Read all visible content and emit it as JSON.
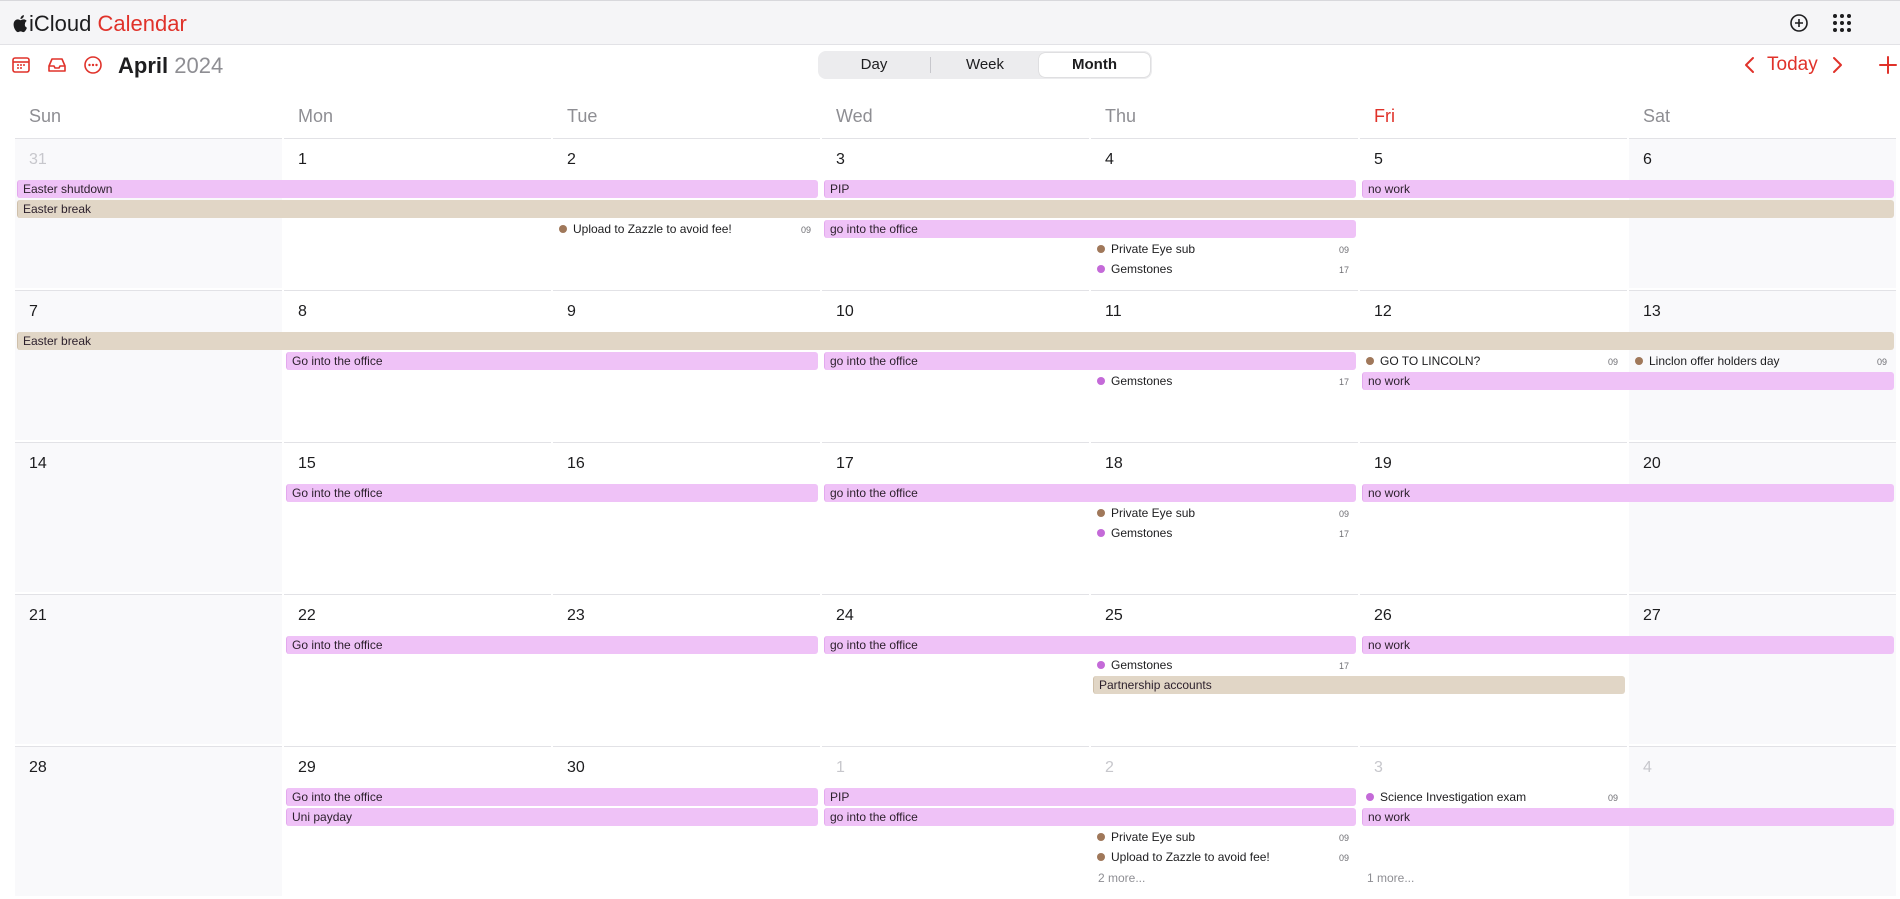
{
  "app": {
    "brand_prefix": "iCloud",
    "brand_name": "Calendar"
  },
  "toolbar": {
    "month": "April",
    "year": "2024",
    "views": [
      {
        "label": "Day",
        "active": false
      },
      {
        "label": "Week",
        "active": false
      },
      {
        "label": "Month",
        "active": true
      }
    ],
    "today_label": "Today"
  },
  "icons": {
    "apple": "apple-logo-icon",
    "new_event_top": "plus-circle-icon",
    "apps": "app-grid-icon",
    "calendars": "calendar-list-icon",
    "inbox": "inbox-icon",
    "more": "ellipsis-circle-icon",
    "prev": "chevron-left-icon",
    "next": "chevron-right-icon",
    "add": "plus-icon"
  },
  "colors": {
    "accent": "#e0322a",
    "event_pink": "#efc2f7",
    "event_tan": "#e1d6c6",
    "dot_brown": "#a0785a",
    "dot_purple": "#c46ad8"
  },
  "weekdays": [
    "Sun",
    "Mon",
    "Tue",
    "Wed",
    "Thu",
    "Fri",
    "Sat"
  ],
  "today_weekday_index": 5,
  "weeks": [
    {
      "days": [
        "31",
        "1",
        "2",
        "3",
        "4",
        "5",
        "6"
      ],
      "dim": [
        true,
        false,
        false,
        false,
        false,
        false,
        false
      ]
    },
    {
      "days": [
        "7",
        "8",
        "9",
        "10",
        "11",
        "12",
        "13"
      ],
      "dim": [
        false,
        false,
        false,
        false,
        false,
        false,
        false
      ]
    },
    {
      "days": [
        "14",
        "15",
        "16",
        "17",
        "18",
        "19",
        "20"
      ],
      "dim": [
        false,
        false,
        false,
        false,
        false,
        false,
        false
      ]
    },
    {
      "days": [
        "21",
        "22",
        "23",
        "24",
        "25",
        "26",
        "27"
      ],
      "dim": [
        false,
        false,
        false,
        false,
        false,
        false,
        false
      ]
    },
    {
      "days": [
        "28",
        "29",
        "30",
        "1",
        "2",
        "3",
        "4"
      ],
      "dim": [
        false,
        false,
        false,
        true,
        true,
        true,
        true
      ]
    }
  ],
  "allday_events": [
    {
      "week": 0,
      "row": 0,
      "start": 0,
      "span": 3,
      "title": "Easter shutdown",
      "color": "pink"
    },
    {
      "week": 0,
      "row": 0,
      "start": 3,
      "span": 2,
      "title": "PIP",
      "color": "pink"
    },
    {
      "week": 0,
      "row": 0,
      "start": 5,
      "span": 2,
      "title": "no work",
      "color": "pink"
    },
    {
      "week": 0,
      "row": 1,
      "start": 0,
      "span": 7,
      "title": "Easter break",
      "color": "tan"
    },
    {
      "week": 0,
      "row": 2,
      "start": 3,
      "span": 2,
      "title": "go into the office",
      "color": "pink"
    },
    {
      "week": 1,
      "row": 0,
      "start": 0,
      "span": 7,
      "title": "Easter break",
      "color": "tan"
    },
    {
      "week": 1,
      "row": 1,
      "start": 1,
      "span": 2,
      "title": "Go into the office",
      "color": "pink"
    },
    {
      "week": 1,
      "row": 1,
      "start": 3,
      "span": 2,
      "title": "go into the office",
      "color": "pink"
    },
    {
      "week": 1,
      "row": 2,
      "start": 5,
      "span": 2,
      "title": "no work",
      "color": "pink"
    },
    {
      "week": 2,
      "row": 0,
      "start": 1,
      "span": 2,
      "title": "Go into the office",
      "color": "pink"
    },
    {
      "week": 2,
      "row": 0,
      "start": 3,
      "span": 2,
      "title": "go into the office",
      "color": "pink"
    },
    {
      "week": 2,
      "row": 0,
      "start": 5,
      "span": 2,
      "title": "no work",
      "color": "pink"
    },
    {
      "week": 3,
      "row": 0,
      "start": 1,
      "span": 2,
      "title": "Go into the office",
      "color": "pink"
    },
    {
      "week": 3,
      "row": 0,
      "start": 3,
      "span": 2,
      "title": "go into the office",
      "color": "pink"
    },
    {
      "week": 3,
      "row": 0,
      "start": 5,
      "span": 2,
      "title": "no work",
      "color": "pink"
    },
    {
      "week": 3,
      "row": 2,
      "start": 4,
      "span": 2,
      "title": "Partnership accounts",
      "color": "tan"
    },
    {
      "week": 4,
      "row": 0,
      "start": 1,
      "span": 2,
      "title": "Go into the office",
      "color": "pink"
    },
    {
      "week": 4,
      "row": 0,
      "start": 3,
      "span": 2,
      "title": "PIP",
      "color": "pink"
    },
    {
      "week": 4,
      "row": 1,
      "start": 1,
      "span": 2,
      "title": "Uni payday",
      "color": "pink"
    },
    {
      "week": 4,
      "row": 1,
      "start": 3,
      "span": 2,
      "title": "go into the office",
      "color": "pink"
    },
    {
      "week": 4,
      "row": 1,
      "start": 5,
      "span": 2,
      "title": "no work",
      "color": "pink"
    }
  ],
  "timed_events": [
    {
      "week": 0,
      "day": 2,
      "row": 2,
      "title": "Upload to Zazzle to avoid fee!",
      "time": "09",
      "dot": "brown"
    },
    {
      "week": 0,
      "day": 4,
      "row": 3,
      "title": "Private Eye sub",
      "time": "09",
      "dot": "brown"
    },
    {
      "week": 0,
      "day": 4,
      "row": 4,
      "title": "Gemstones",
      "time": "17",
      "dot": "purple"
    },
    {
      "week": 1,
      "day": 4,
      "row": 2,
      "title": "Gemstones",
      "time": "17",
      "dot": "purple"
    },
    {
      "week": 1,
      "day": 5,
      "row": 1,
      "title": "GO TO LINCOLN?",
      "time": "09",
      "dot": "brown"
    },
    {
      "week": 1,
      "day": 6,
      "row": 1,
      "title": "Linclon offer holders day",
      "time": "09",
      "dot": "brown"
    },
    {
      "week": 2,
      "day": 4,
      "row": 1,
      "title": "Private Eye sub",
      "time": "09",
      "dot": "brown"
    },
    {
      "week": 2,
      "day": 4,
      "row": 2,
      "title": "Gemstones",
      "time": "17",
      "dot": "purple"
    },
    {
      "week": 3,
      "day": 4,
      "row": 1,
      "title": "Gemstones",
      "time": "17",
      "dot": "purple"
    },
    {
      "week": 4,
      "day": 5,
      "row": 0,
      "title": "Science Investigation exam",
      "time": "09",
      "dot": "purple"
    },
    {
      "week": 4,
      "day": 4,
      "row": 2,
      "title": "Private Eye sub",
      "time": "09",
      "dot": "brown"
    },
    {
      "week": 4,
      "day": 4,
      "row": 3,
      "title": "Upload to Zazzle to avoid fee!",
      "time": "09",
      "dot": "brown"
    }
  ],
  "more_links": [
    {
      "week": 4,
      "day": 4,
      "label": "2 more..."
    },
    {
      "week": 4,
      "day": 5,
      "label": "1 more..."
    }
  ]
}
